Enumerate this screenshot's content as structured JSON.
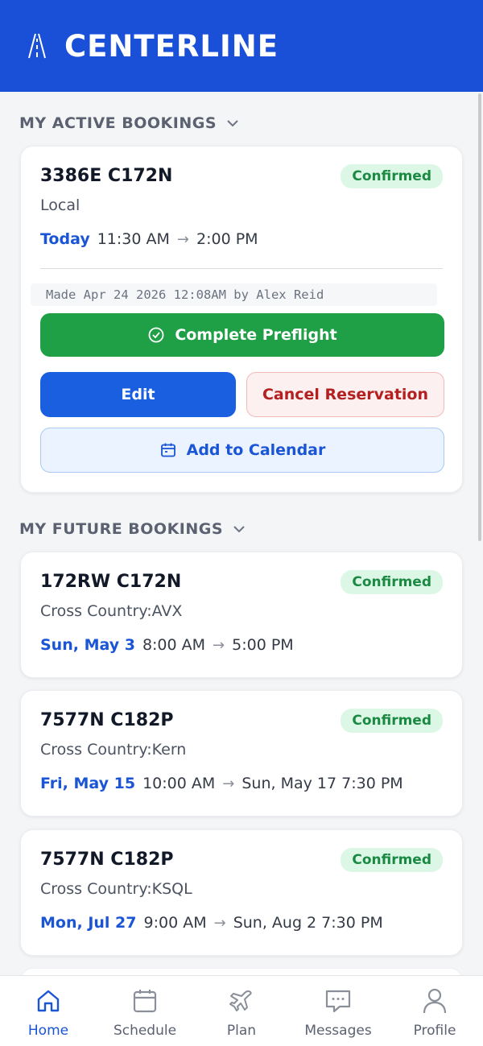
{
  "app": {
    "brand": "CENTERLINE"
  },
  "sections": {
    "active_title": "MY ACTIVE BOOKINGS",
    "future_title": "MY FUTURE BOOKINGS"
  },
  "active_booking": {
    "tail": "3386E C172N",
    "status": "Confirmed",
    "purpose": "Local",
    "day": "Today",
    "start": "11:30 AM",
    "end": "2:00 PM",
    "made_by": "Made Apr 24 2026 12:08AM by Alex Reid",
    "preflight_label": "Complete Preflight",
    "edit_label": "Edit",
    "cancel_label": "Cancel Reservation",
    "calendar_label": "Add to Calendar"
  },
  "future_bookings": [
    {
      "tail": "172RW C172N",
      "status": "Confirmed",
      "purpose": "Cross Country:AVX",
      "day": "Sun, May 3",
      "start": "8:00 AM",
      "end": "5:00 PM"
    },
    {
      "tail": "7577N C182P",
      "status": "Confirmed",
      "purpose": "Cross Country:Kern",
      "day": "Fri, May 15",
      "start": "10:00 AM",
      "end": "Sun, May 17 7:30 PM"
    },
    {
      "tail": "7577N C182P",
      "status": "Confirmed",
      "purpose": "Cross Country:KSQL",
      "day": "Mon, Jul 27",
      "start": "9:00 AM",
      "end": "Sun, Aug 2 7:30 PM"
    }
  ],
  "nav": [
    {
      "label": "Home",
      "icon": "home-icon",
      "active": true
    },
    {
      "label": "Schedule",
      "icon": "calendar-icon",
      "active": false
    },
    {
      "label": "Plan",
      "icon": "plane-icon",
      "active": false
    },
    {
      "label": "Messages",
      "icon": "chat-icon",
      "active": false
    },
    {
      "label": "Profile",
      "icon": "user-icon",
      "active": false
    }
  ],
  "colors": {
    "header": "#1a4fd8",
    "confirmed_bg": "#dcf7e6",
    "confirmed_text": "#1a8a43",
    "preflight": "#1fa046",
    "edit": "#1a5fe0",
    "cancel_text": "#b42020",
    "accent_day": "#1a55d6"
  }
}
